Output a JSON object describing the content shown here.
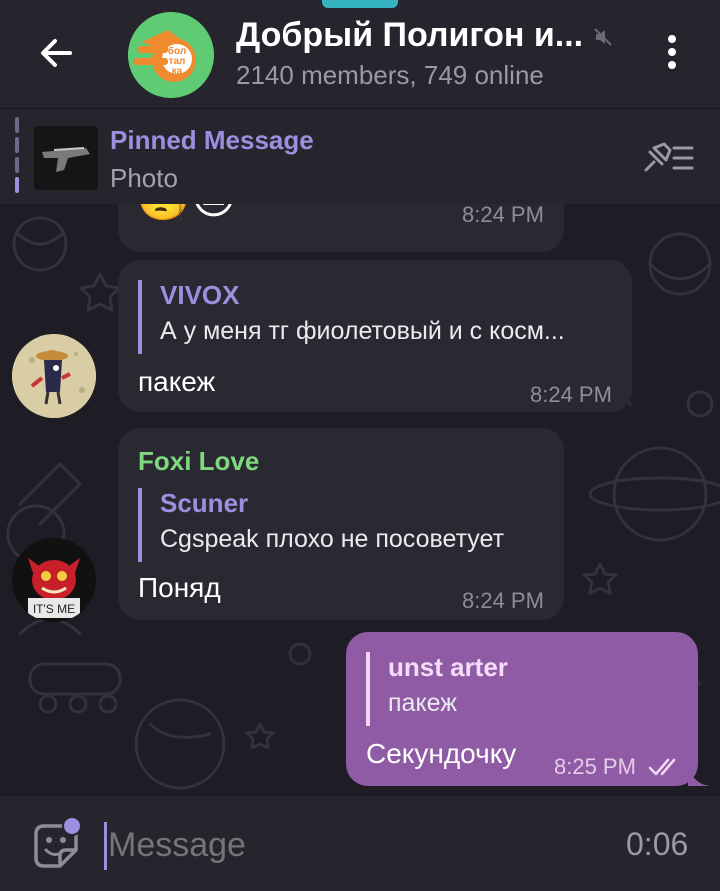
{
  "header": {
    "title": "Добрый Полигон и...",
    "subtitle": "2140 members, 749 online",
    "avatar_text": [
      "бол",
      "тал",
      "ка"
    ]
  },
  "pinned": {
    "title": "Pinned Message",
    "subtitle": "Photo"
  },
  "messages": [
    {
      "id": "m1",
      "content": "🧐😐",
      "time": "8:24 PM"
    },
    {
      "id": "m2",
      "reply_name": "VIVOX",
      "reply_text": "А у меня тг фиолетовый и с косм...",
      "text": "пакеж",
      "time": "8:24 PM"
    },
    {
      "id": "m3",
      "sender": "Foxi Love",
      "reply_name": "Scuner",
      "reply_text": "Cgspeak плохо не посоветует",
      "text": "Поняд",
      "time": "8:24 PM",
      "avatar_caption": "IT'S ME"
    },
    {
      "id": "m4",
      "reply_name": "unst arter",
      "reply_text": "пакеж",
      "text": "Секундочку",
      "time": "8:25 PM",
      "outgoing": true
    }
  ],
  "input": {
    "placeholder": "Message",
    "timer": "0:06"
  },
  "colors": {
    "accent": "#9c8fe0",
    "outgoing_bubble": "#8f5ba4",
    "incoming_bubble": "#2a2931",
    "sender_foxi": "#7ed87e"
  }
}
